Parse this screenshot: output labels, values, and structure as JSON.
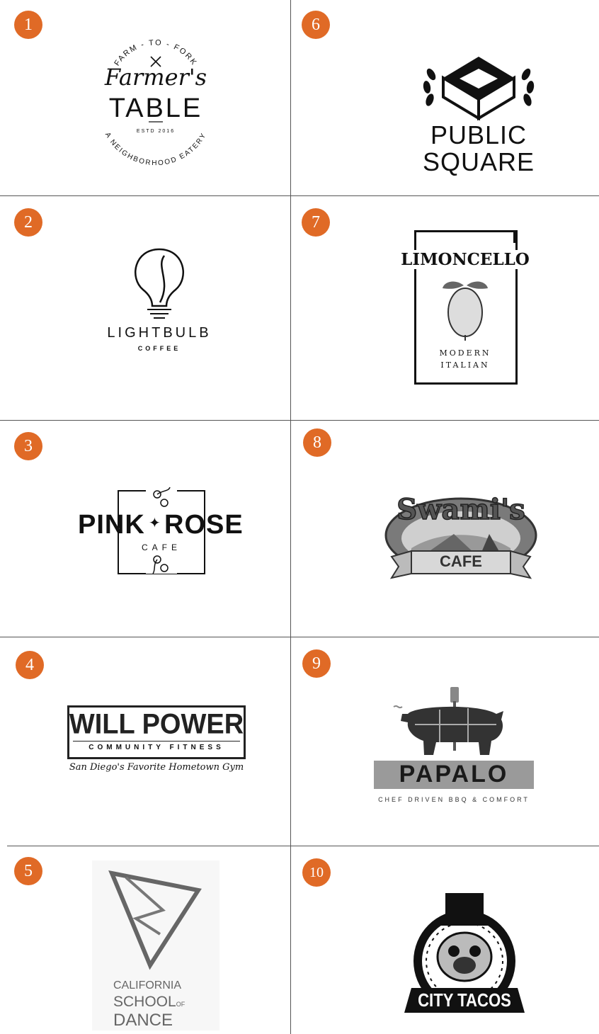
{
  "badge_color": "#e06a26",
  "logos": [
    {
      "number": "1",
      "arc_top": "FARM - TO - FORK",
      "script": "Farmer's",
      "word": "TABLE",
      "estd": "ESTD 2016",
      "arc_bottom": "A NEIGHBORHOOD EATERY"
    },
    {
      "number": "2",
      "name": "LIGHTBULB",
      "sub": "COFFEE"
    },
    {
      "number": "3",
      "left": "PINK",
      "right": "ROSE",
      "sub": "CAFE"
    },
    {
      "number": "4",
      "title": "WILL POWER",
      "sub": "COMMUNITY FITNESS",
      "tagline": "San Diego's Favorite Hometown Gym"
    },
    {
      "number": "5",
      "line1": "CALIFORNIA",
      "line2": "SCHOOL",
      "line2_suffix": "OF",
      "line3": "DANCE"
    },
    {
      "number": "6",
      "line1": "PUBLIC",
      "line2": "SQUARE"
    },
    {
      "number": "7",
      "name": "LIMONCELLO",
      "line1": "MODERN",
      "line2": "ITALIAN"
    },
    {
      "number": "8",
      "name": "Swami's",
      "sub": "CAFE"
    },
    {
      "number": "9",
      "name": "PAPALO",
      "tagline": "CHEF DRIVEN BBQ & COMFORT"
    },
    {
      "number": "10",
      "name": "CITY TACOS"
    }
  ]
}
